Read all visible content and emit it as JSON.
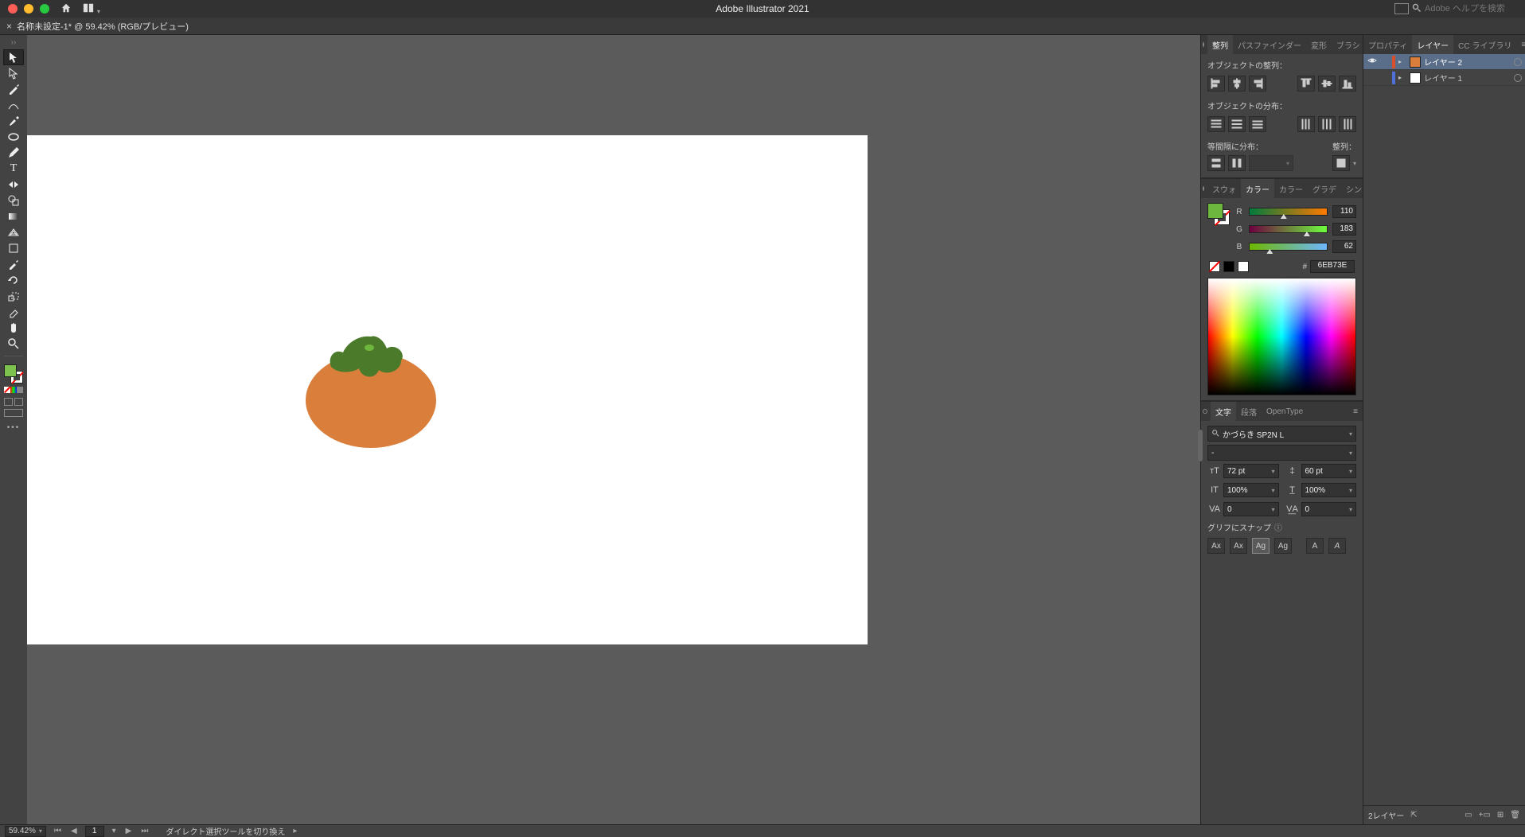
{
  "app": {
    "title": "Adobe Illustrator 2021",
    "search_placeholder": "Adobe ヘルプを検索"
  },
  "document": {
    "tab": "名称未設定-1* @ 59.42% (RGB/プレビュー)"
  },
  "align_panel": {
    "tabs": [
      "整列",
      "パスファインダー",
      "変形",
      "ブラシ"
    ],
    "label_align": "オブジェクトの整列：",
    "label_dist": "オブジェクトの分布：",
    "label_spacing": "等間隔に分布：",
    "label_alignto": "整列："
  },
  "color_panel": {
    "tabs": [
      "スウォ",
      "カラー",
      "カラー",
      "グラデ",
      "シンボ"
    ],
    "r": "110",
    "g": "183",
    "b": "62",
    "hex_prefix": "#",
    "hex": "6EB73E"
  },
  "char_panel": {
    "tabs": [
      "文字",
      "段落",
      "OpenType"
    ],
    "font": "かづらき SP2N L",
    "style": "-",
    "size": "72 pt",
    "leading": "60 pt",
    "vscale": "100%",
    "hscale": "100%",
    "kerning": "0",
    "tracking": "0",
    "glyph_label": "グリフにスナップ"
  },
  "layers_panel": {
    "tabs": [
      "プロパティ",
      "レイヤー",
      "CC ライブラリ"
    ],
    "layers": [
      {
        "name": "レイヤー 2",
        "color": "#d94f2b",
        "thumb": "#d97f3b",
        "selected": true
      },
      {
        "name": "レイヤー 1",
        "color": "#4f6fd9",
        "thumb": "#ffffff",
        "selected": false
      }
    ],
    "footer_count": "2レイヤー"
  },
  "statusbar": {
    "zoom": "59.42%",
    "page": "1",
    "hint": "ダイレクト選択ツールを切り換え"
  },
  "info_icon_char": "ⓘ"
}
